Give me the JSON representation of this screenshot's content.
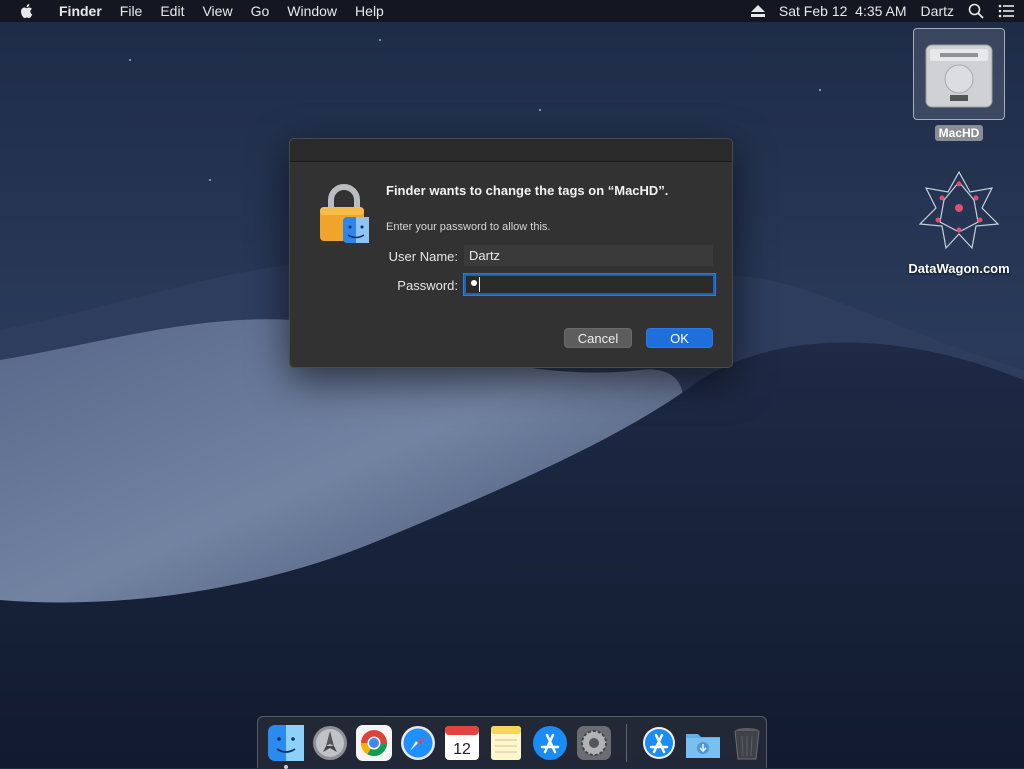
{
  "menubar": {
    "app_name": "Finder",
    "menus": [
      "File",
      "Edit",
      "View",
      "Go",
      "Window",
      "Help"
    ],
    "date_time": "Sat Feb 12  4:35 AM",
    "user": "Dartz",
    "icons": [
      "apple-icon",
      "eject-icon",
      "spotlight-search-icon",
      "notification-center-icon"
    ]
  },
  "desktop": {
    "icons": [
      {
        "label": "MacHD",
        "icon": "hard-drive-icon"
      },
      {
        "label": "DataWagon.com",
        "icon": "datawagon-logo-icon"
      }
    ]
  },
  "dialog": {
    "heading": "Finder wants to change the tags on “MacHD”.",
    "subtext": "Enter your password to allow this.",
    "username_label": "User Name:",
    "username_value": "Dartz",
    "password_label": "Password:",
    "password_value": "•",
    "cancel_label": "Cancel",
    "ok_label": "OK",
    "accent_color": "#1e6fdb"
  },
  "dock": {
    "items": [
      {
        "name": "Finder",
        "icon": "finder-icon",
        "running": true
      },
      {
        "name": "Launchpad",
        "icon": "launchpad-icon"
      },
      {
        "name": "Google Chrome",
        "icon": "chrome-icon"
      },
      {
        "name": "Safari",
        "icon": "safari-icon"
      },
      {
        "name": "Calendar",
        "icon": "calendar-icon",
        "month": "FEB",
        "day": "12"
      },
      {
        "name": "Notes",
        "icon": "notes-icon"
      },
      {
        "name": "App Store",
        "icon": "app-store-icon"
      },
      {
        "name": "System Preferences",
        "icon": "system-preferences-icon"
      },
      {
        "name": "Applications",
        "icon": "applications-folder-icon"
      },
      {
        "name": "Downloads",
        "icon": "downloads-folder-icon"
      },
      {
        "name": "Trash",
        "icon": "trash-icon"
      }
    ]
  }
}
